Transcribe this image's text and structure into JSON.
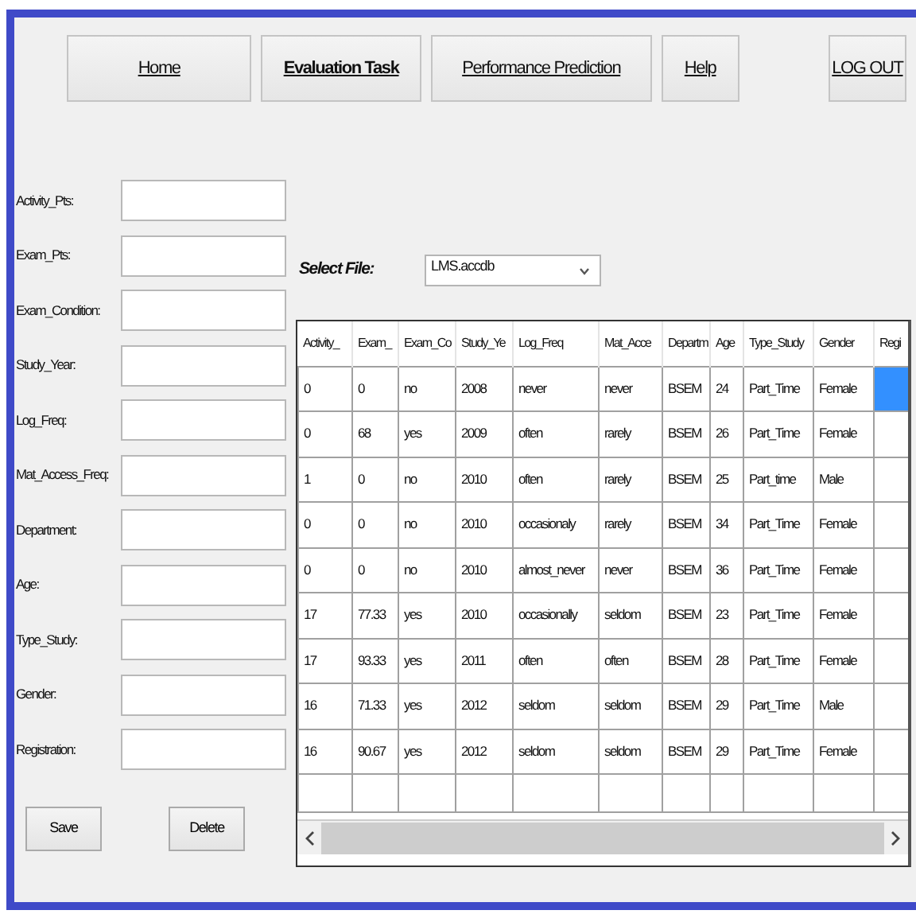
{
  "nav": [
    {
      "label": "Home",
      "selected": false
    },
    {
      "label": "Evaluation Task",
      "selected": true
    },
    {
      "label": "Performance Prediction",
      "selected": false
    },
    {
      "label": "Help",
      "selected": false
    },
    {
      "label": "LOG OUT",
      "selected": false,
      "kind": "logout"
    }
  ],
  "form": {
    "fields": [
      "Activity_Pts:",
      "Exam_Pts:",
      "Exam_Condition:",
      "Study_Year:",
      "Log_Freq:",
      "Mat_Access_Freq:",
      "Department:",
      "Age:",
      "Type_Study:",
      "Gender:",
      "Registration:"
    ],
    "buttons": [
      "Save",
      "Delete"
    ]
  },
  "file_select": {
    "label": "Select File:",
    "value": "LMS.accdb"
  },
  "table": {
    "columns": [
      "Activity_",
      "Exam_",
      "Exam_Co",
      "Study_Ye",
      "Log_Freq",
      "Mat_Acce",
      "Departm",
      "Age",
      "Type_Study",
      "Gender",
      "Regi"
    ],
    "rows": [
      {
        "cells": [
          "0",
          "0",
          "no",
          "2008",
          "never",
          "never",
          "BSEM",
          "24",
          "Part_Time",
          "Female"
        ],
        "selected": true
      },
      {
        "cells": [
          "0",
          "68",
          "yes",
          "2009",
          "often",
          "rarely",
          "BSEM",
          "26",
          "Part_Time",
          "Female"
        ],
        "selected": false
      },
      {
        "cells": [
          "1",
          "0",
          "no",
          "2010",
          "often",
          "rarely",
          "BSEM",
          "25",
          "Part_time",
          "Male"
        ],
        "selected": false
      },
      {
        "cells": [
          "0",
          "0",
          "no",
          "2010",
          "occasionaly",
          "rarely",
          "BSEM",
          "34",
          "Part_Time",
          "Female"
        ],
        "selected": false
      },
      {
        "cells": [
          "0",
          "0",
          "no",
          "2010",
          "almost_never",
          "never",
          "BSEM",
          "36",
          "Part_Time",
          "Female"
        ],
        "selected": false
      },
      {
        "cells": [
          "17",
          "77.33",
          "yes",
          "2010",
          "occasionally",
          "seldom",
          "BSEM",
          "23",
          "Part_Time",
          "Female"
        ],
        "selected": false
      },
      {
        "cells": [
          "17",
          "93.33",
          "yes",
          "2011",
          "often",
          "often",
          "BSEM",
          "28",
          "Part_Time",
          "Female"
        ],
        "selected": false
      },
      {
        "cells": [
          "16",
          "71.33",
          "yes",
          "2012",
          "seldom",
          "seldom",
          "BSEM",
          "29",
          "Part_Time",
          "Male"
        ],
        "selected": false
      },
      {
        "cells": [
          "16",
          "90.67",
          "yes",
          "2012",
          "seldom",
          "seldom",
          "BSEM",
          "29",
          "Part_Time",
          "Female"
        ],
        "selected": false
      }
    ]
  }
}
